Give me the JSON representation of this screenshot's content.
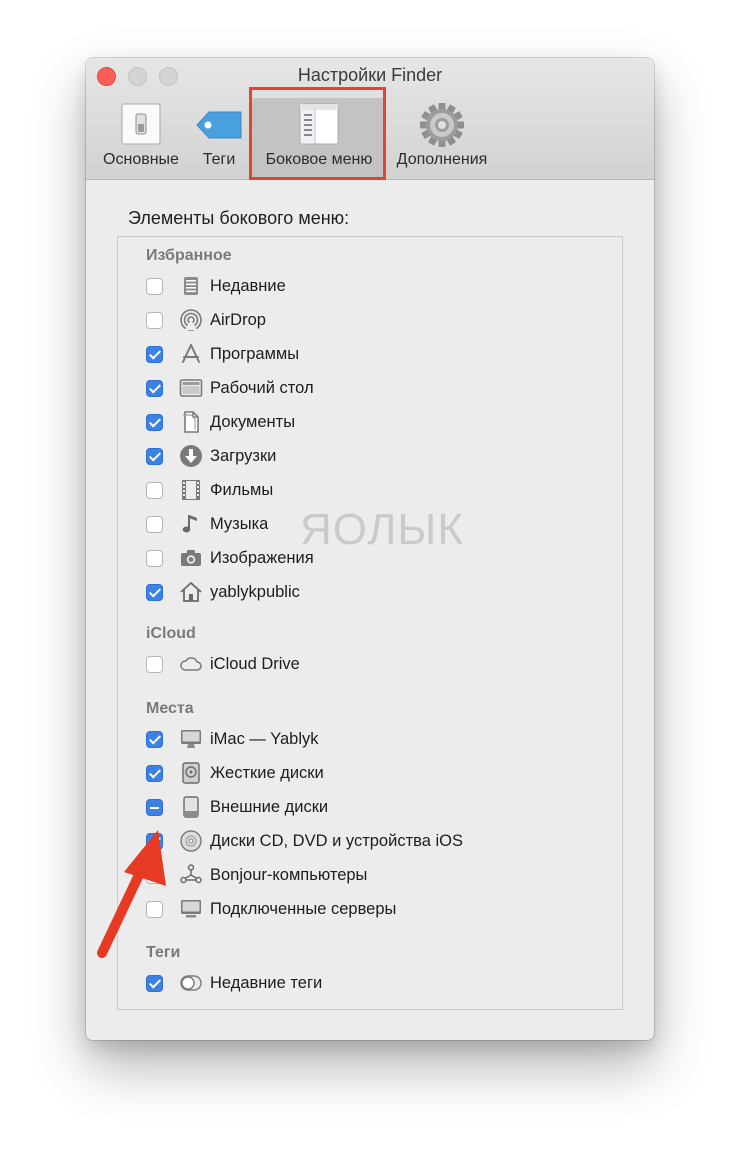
{
  "window": {
    "title": "Настройки Finder"
  },
  "toolbar": {
    "tabs": [
      {
        "label": "Основные",
        "icon": "general-switch-icon"
      },
      {
        "label": "Теги",
        "icon": "tag-icon"
      },
      {
        "label": "Боковое меню",
        "icon": "sidebar-icon",
        "active": true
      },
      {
        "label": "Дополнения",
        "icon": "gear-icon"
      }
    ]
  },
  "content": {
    "heading": "Элементы бокового меню:",
    "groups": {
      "favorites": {
        "title": "Избранное",
        "items": [
          {
            "label": "Недавние",
            "icon": "recents-icon",
            "checked": false
          },
          {
            "label": "AirDrop",
            "icon": "airdrop-icon",
            "checked": false
          },
          {
            "label": "Программы",
            "icon": "applications-icon",
            "checked": true
          },
          {
            "label": "Рабочий стол",
            "icon": "desktop-icon",
            "checked": true
          },
          {
            "label": "Документы",
            "icon": "documents-icon",
            "checked": true
          },
          {
            "label": "Загрузки",
            "icon": "downloads-icon",
            "checked": true
          },
          {
            "label": "Фильмы",
            "icon": "movies-icon",
            "checked": false
          },
          {
            "label": "Музыка",
            "icon": "music-icon",
            "checked": false
          },
          {
            "label": "Изображения",
            "icon": "pictures-icon",
            "checked": false
          },
          {
            "label": "yablykpublic",
            "icon": "home-icon",
            "checked": true
          }
        ]
      },
      "icloud": {
        "title": "iCloud",
        "items": [
          {
            "label": "iCloud Drive",
            "icon": "cloud-icon",
            "checked": false
          }
        ]
      },
      "locations": {
        "title": "Места",
        "items": [
          {
            "label": "iMac — Yablyk",
            "icon": "imac-icon",
            "checked": true
          },
          {
            "label": "Жесткие диски",
            "icon": "hard-disk-icon",
            "checked": true
          },
          {
            "label": "Внешние диски",
            "icon": "external-disk-icon",
            "state": "mixed"
          },
          {
            "label": "Диски CD, DVD и устройства iOS",
            "icon": "cd-dvd-icon",
            "checked": true
          },
          {
            "label": "Bonjour-компьютеры",
            "icon": "bonjour-icon",
            "checked": false
          },
          {
            "label": "Подключенные серверы",
            "icon": "server-icon",
            "checked": false
          }
        ]
      },
      "tags": {
        "title": "Теги",
        "items": [
          {
            "label": "Недавние теги",
            "icon": "tag-circle-icon",
            "checked": true
          }
        ]
      }
    }
  },
  "watermark": "ЯОЛЫК",
  "colors": {
    "highlight": "#e14530",
    "checkbox_accent": "#3b82e4",
    "arrow": "#e63a25"
  }
}
